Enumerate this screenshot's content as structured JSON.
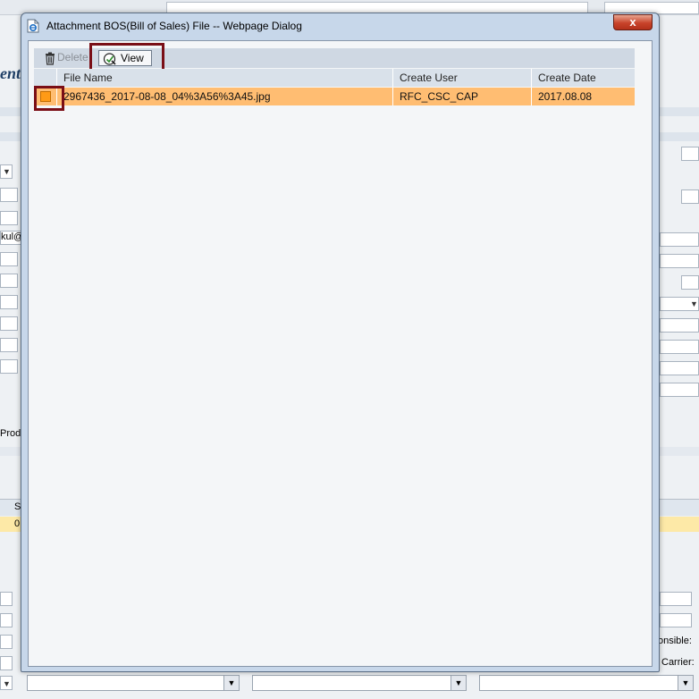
{
  "dialog": {
    "title": "Attachment BOS(Bill of Sales) File -- Webpage Dialog",
    "close_label": "x"
  },
  "toolbar": {
    "delete_label": "Delete",
    "view_label": "View"
  },
  "grid": {
    "columns": [
      "File Name",
      "Create User",
      "Create Date"
    ],
    "rows": [
      {
        "file_name": "2967436_2017-08-08_04%3A56%3A45.jpg",
        "create_user": "RFC_CSC_CAP",
        "create_date": "2017.08.08"
      }
    ]
  },
  "background": {
    "title_fragment": "enti",
    "email_fragment": "kul@",
    "product_fragment": "Prod",
    "header_fragment": "S",
    "row_fragment": "0",
    "responsible_label": "onsible:",
    "carrier_label": "Carrier:"
  },
  "colors": {
    "selected_row": "#ffbd72",
    "highlight_border": "#7a0e16",
    "dialog_frame": "#c7d7ea"
  }
}
